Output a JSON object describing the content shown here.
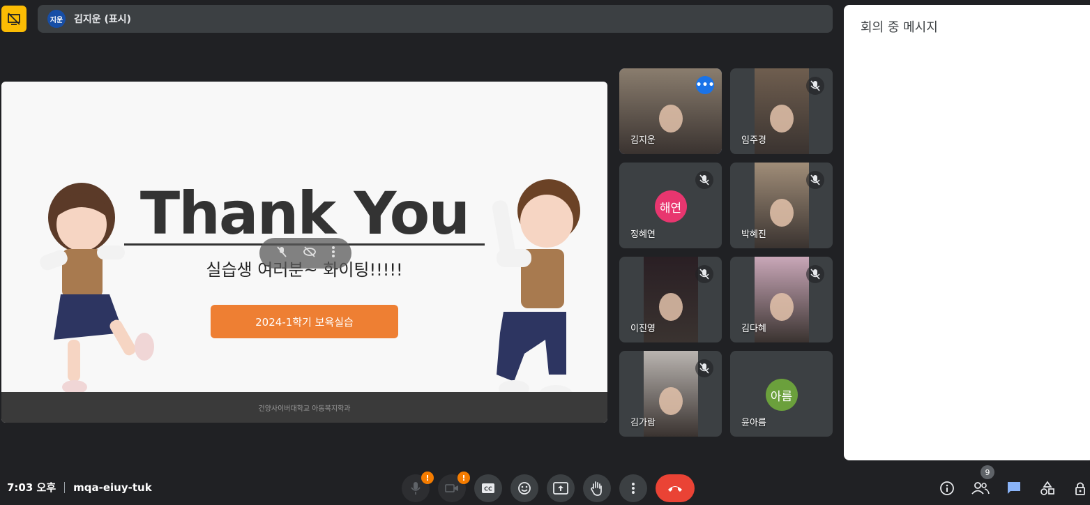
{
  "presenter": {
    "avatar_text": "지운",
    "label": "김지운 (표시)"
  },
  "slide": {
    "title": "Thank You",
    "subtitle": "실습생 여러분~ 화이팅!!!!!",
    "button_label": "2024-1학기 보육실습",
    "footer": "건양사이버대학교 아동복지학과"
  },
  "participants": [
    {
      "name": "김지운",
      "kind": "video",
      "muted": false,
      "active": true,
      "color": "#8a7d6e"
    },
    {
      "name": "임주경",
      "kind": "video",
      "muted": true,
      "active": false,
      "color": "#6f5e4f"
    },
    {
      "name": "정혜연",
      "kind": "avatar",
      "avatar": "해연",
      "avatar_color": "#e8366f",
      "muted": true,
      "active": false
    },
    {
      "name": "박혜진",
      "kind": "video",
      "muted": true,
      "active": false,
      "color": "#a08d78"
    },
    {
      "name": "이진영",
      "kind": "video",
      "muted": true,
      "active": false,
      "color": "#2a1f24"
    },
    {
      "name": "김다혜",
      "kind": "video",
      "muted": true,
      "active": false,
      "color": "#c9a7b8"
    },
    {
      "name": "김가람",
      "kind": "video",
      "muted": true,
      "active": false,
      "color": "#b9b4b0"
    },
    {
      "name": "윤아름",
      "kind": "avatar",
      "avatar": "아름",
      "avatar_color": "#6ba03c",
      "muted": false,
      "active": false
    }
  ],
  "chat": {
    "title": "회의 중 메시지"
  },
  "meeting": {
    "time": "7:03 오후",
    "code": "mqa-eiuy-tuk"
  },
  "controls": {
    "mic_badge": "!",
    "cam_badge": "!",
    "participant_count": "9"
  },
  "colors": {
    "accent": "#8ab4f8",
    "end_call": "#ea4335",
    "warning": "#f57c00",
    "slide_button": "#ee7f33"
  }
}
